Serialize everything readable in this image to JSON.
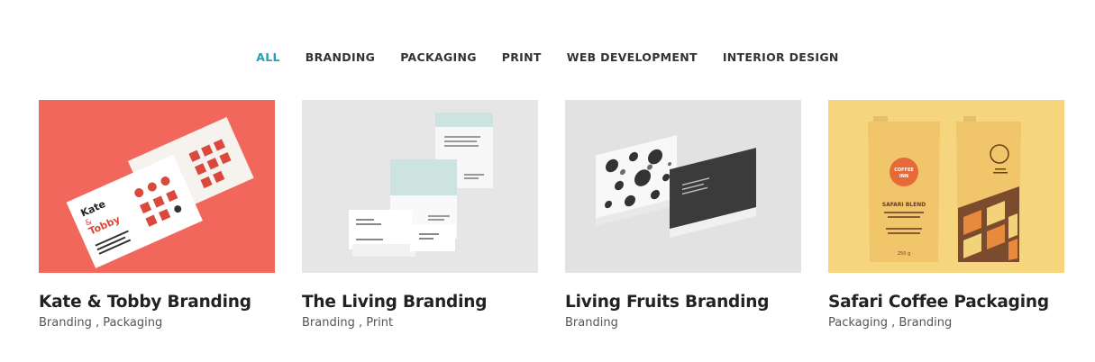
{
  "filters": [
    {
      "label": "ALL",
      "active": true
    },
    {
      "label": "BRANDING",
      "active": false
    },
    {
      "label": "PACKAGING",
      "active": false
    },
    {
      "label": "PRINT",
      "active": false
    },
    {
      "label": "WEB DEVELOPMENT",
      "active": false
    },
    {
      "label": "INTERIOR DESIGN",
      "active": false
    }
  ],
  "colors": {
    "accent": "#1aa6b7",
    "card1_bg": "#f2675b",
    "card2_bg": "#e6e6e6",
    "card3_bg": "#e2e2e2",
    "card4_bg": "#f6d57f"
  },
  "portfolio": [
    {
      "title": "Kate & Tobby Branding",
      "categories": "Branding , Packaging",
      "image": "business-cards-on-red",
      "image_text": [
        "Kate",
        "&",
        "Tobby"
      ]
    },
    {
      "title": "The Living Branding",
      "categories": "Branding , Print",
      "image": "envelopes-and-stationery",
      "image_text": []
    },
    {
      "title": "Living Fruits Branding",
      "categories": "Branding",
      "image": "fruit-pattern-business-cards",
      "image_text": []
    },
    {
      "title": "Safari Coffee Packaging",
      "categories": "Packaging , Branding",
      "image": "coffee-bags-on-yellow",
      "image_text": [
        "COFFEE",
        "INN",
        "SAFARI BLEND",
        "250 g"
      ]
    }
  ]
}
